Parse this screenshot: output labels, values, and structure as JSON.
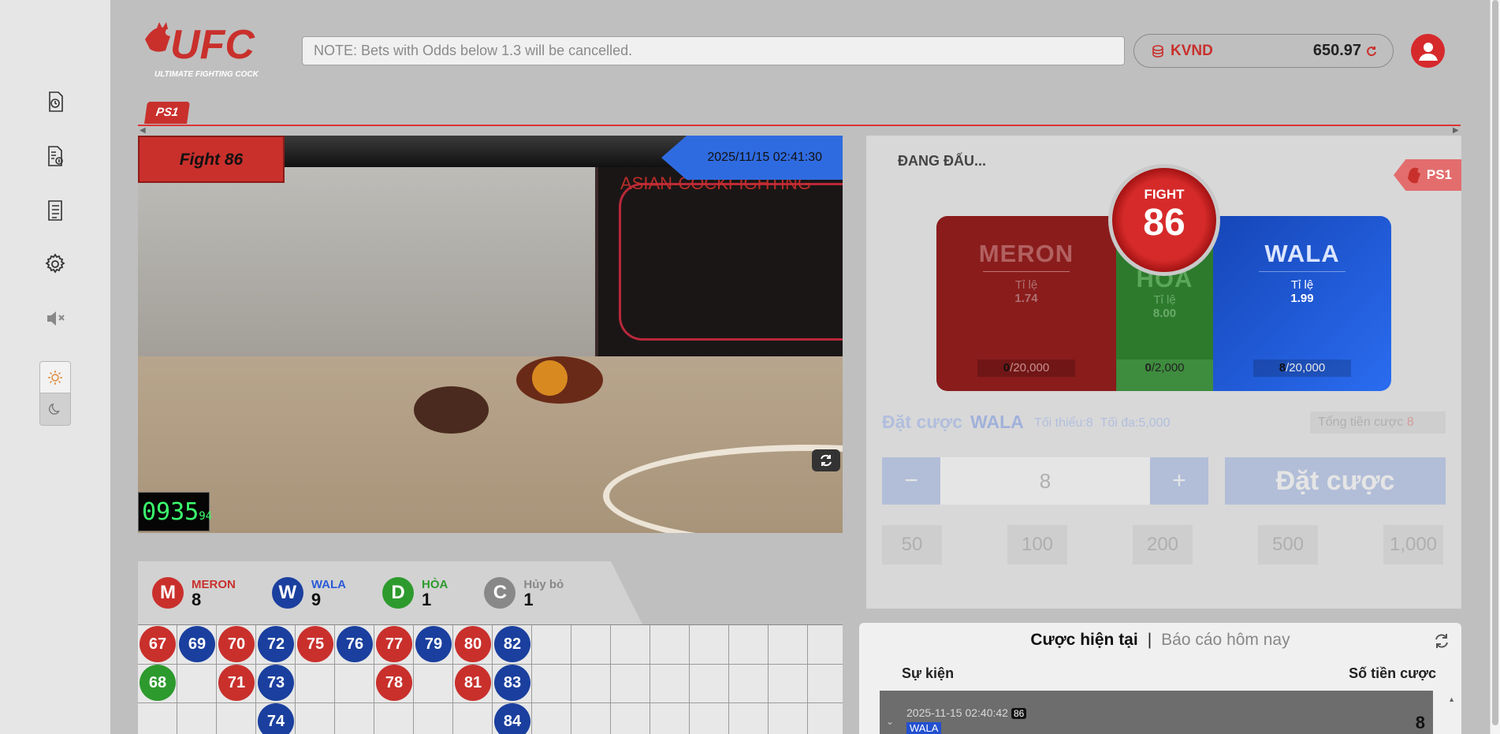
{
  "header": {
    "logo_text": "UFC",
    "logo_subtitle": "ULTIMATE FIGHTING COCK",
    "notice": "NOTE: Bets with Odds below 1.3 will be cancelled.",
    "currency": "KVND",
    "balance": "650.97"
  },
  "tab": {
    "label": "PS1"
  },
  "video": {
    "fight_label": "Fight 86",
    "datetime": "2025/11/15 02:41:30",
    "overlay_text": "ASIAN-COCKFIGHTING",
    "timer_main": "0935",
    "timer_small": "94"
  },
  "stats": [
    {
      "letter": "M",
      "label": "MERON",
      "count": "8",
      "color": "#c9302c"
    },
    {
      "letter": "W",
      "label": "WALA",
      "count": "9",
      "color": "#1a3f9e"
    },
    {
      "letter": "D",
      "label": "HÒA",
      "count": "1",
      "color": "#2d9a2d"
    },
    {
      "letter": "C",
      "label": "Hủy bỏ",
      "count": "1",
      "color": "#888888"
    }
  ],
  "results_grid": {
    "columns": [
      [
        {
          "n": "67",
          "s": "M"
        },
        {
          "n": "68",
          "s": "D"
        }
      ],
      [
        {
          "n": "69",
          "s": "W"
        }
      ],
      [
        {
          "n": "70",
          "s": "M"
        },
        {
          "n": "71",
          "s": "M"
        }
      ],
      [
        {
          "n": "72",
          "s": "W"
        },
        {
          "n": "73",
          "s": "W"
        },
        {
          "n": "74",
          "s": "W"
        }
      ],
      [
        {
          "n": "75",
          "s": "M"
        }
      ],
      [
        {
          "n": "76",
          "s": "W"
        }
      ],
      [
        {
          "n": "77",
          "s": "M"
        },
        {
          "n": "78",
          "s": "M"
        }
      ],
      [
        {
          "n": "79",
          "s": "W"
        }
      ],
      [
        {
          "n": "80",
          "s": "M"
        },
        {
          "n": "81",
          "s": "M"
        }
      ],
      [
        {
          "n": "82",
          "s": "W"
        },
        {
          "n": "83",
          "s": "W"
        },
        {
          "n": "84",
          "s": "W"
        }
      ]
    ]
  },
  "bet": {
    "status": "ĐANG ĐẤU...",
    "ps_badge": "PS1",
    "fight_title": "FIGHT",
    "fight_number": "86",
    "meron": {
      "name": "MERON",
      "odds_label": "Tỉ lệ",
      "odds": "1.74",
      "pool_bet": "0",
      "pool_max": "/20,000"
    },
    "hoa": {
      "name": "HÒA",
      "odds_label": "Tỉ lệ",
      "odds": "8.00",
      "pool_bet": "0",
      "pool_max": "/2,000"
    },
    "wala": {
      "name": "WALA",
      "odds_label": "Tỉ lệ",
      "odds": "1.99",
      "pool_bet": "8",
      "pool_max": "/20,000"
    },
    "place_label": "Đặt cược",
    "selected_side": "WALA",
    "min_label": "Tối thiểu:8",
    "max_label": "Tối đa:5,000",
    "total_label": "Tổng tiền cược",
    "total_value": "8",
    "amount": "8",
    "minus": "−",
    "plus": "+",
    "submit": "Đặt cược",
    "chips": [
      "50",
      "100",
      "200",
      "500",
      "1,000"
    ]
  },
  "history": {
    "tab_current": "Cược hiện tại",
    "separator": "|",
    "tab_report": "Báo cáo hôm nay",
    "col_event": "Sự kiện",
    "col_amount": "Số tiền cược",
    "rows": [
      {
        "datetime": "2025-11-15 02:40:42",
        "fight": "86",
        "side": "WALA",
        "amount": "8"
      }
    ]
  },
  "colors": {
    "meron": "#c9302c",
    "wala": "#1a3f9e",
    "hoa": "#2d9a2d",
    "cancel": "#888888"
  }
}
